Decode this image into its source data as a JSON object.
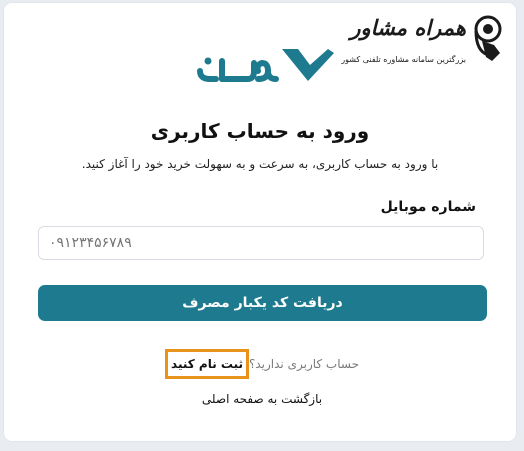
{
  "watermark": {
    "script_text": "همراه مشاور",
    "tagline": "بزرگترین سامانه مشاوره تلفنی کشور"
  },
  "logo": {
    "text": "وایب",
    "brand_color": "#1e7a8e"
  },
  "title": "ورود به حساب کاربری",
  "subtitle": "با ورود به حساب کاربری، به سرعت و به سهولت خرید خود را آغاز کنید.",
  "mobile_field": {
    "label": "شماره موبایل",
    "placeholder": "۰۹۱۲۳۴۵۶۷۸۹",
    "value": ""
  },
  "submit_label": "دریافت کد یکبار مصرف",
  "signup": {
    "question": "حساب کاربری ندارید؟",
    "link": "ثبت نام کنید",
    "highlight_color": "#e8941c"
  },
  "back_link": "بازگشت به صفحه اصلی"
}
